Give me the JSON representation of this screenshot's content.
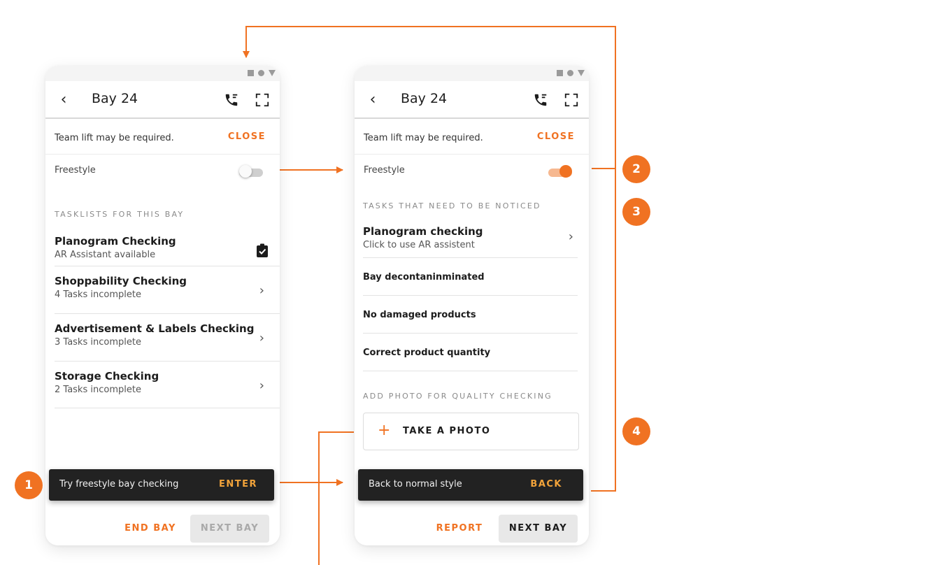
{
  "colors": {
    "accent": "#f07222",
    "snackbar_bg": "#222222",
    "snackbar_action": "#f2a33a"
  },
  "screens": {
    "left": {
      "title": "Bay 24",
      "notice": {
        "text": "Team lift may be required.",
        "action": "CLOSE"
      },
      "freestyle": {
        "label": "Freestyle",
        "on": false
      },
      "section_title": "TASKLISTS FOR THIS BAY",
      "tasklists": [
        {
          "title": "Planogram Checking",
          "subtitle": "AR Assistant available",
          "icon": "clipboard-check-icon"
        },
        {
          "title": "Shoppability Checking",
          "subtitle": "4 Tasks incomplete",
          "icon": "chevron-right-icon"
        },
        {
          "title": "Advertisement & Labels Checking",
          "subtitle": "3 Tasks incomplete",
          "icon": "chevron-right-icon"
        },
        {
          "title": "Storage Checking",
          "subtitle": "2 Tasks incomplete",
          "icon": "chevron-right-icon"
        }
      ],
      "snackbar": {
        "text": "Try freestyle bay checking",
        "action": "ENTER"
      },
      "bottom": {
        "secondary": "END BAY",
        "primary": "NEXT BAY",
        "primary_enabled": false
      }
    },
    "right": {
      "title": "Bay 24",
      "notice": {
        "text": "Team lift may be required.",
        "action": "CLOSE"
      },
      "freestyle": {
        "label": "Freestyle",
        "on": true
      },
      "section_title": "TASKS THAT NEED TO BE NOTICED",
      "planogram": {
        "title": "Planogram checking",
        "subtitle": "Click to use AR assistent"
      },
      "tasks": [
        "Bay decontaninminated",
        "No damaged products",
        "Correct product quantity"
      ],
      "photo_section_title": "ADD PHOTO FOR QUALITY CHECKING",
      "photo_button": "TAKE A PHOTO",
      "snackbar": {
        "text": "Back to normal style",
        "action": "BACK"
      },
      "bottom": {
        "secondary": "REPORT",
        "primary": "NEXT BAY",
        "primary_enabled": true
      }
    }
  },
  "annotations": [
    "1",
    "2",
    "3",
    "4"
  ]
}
